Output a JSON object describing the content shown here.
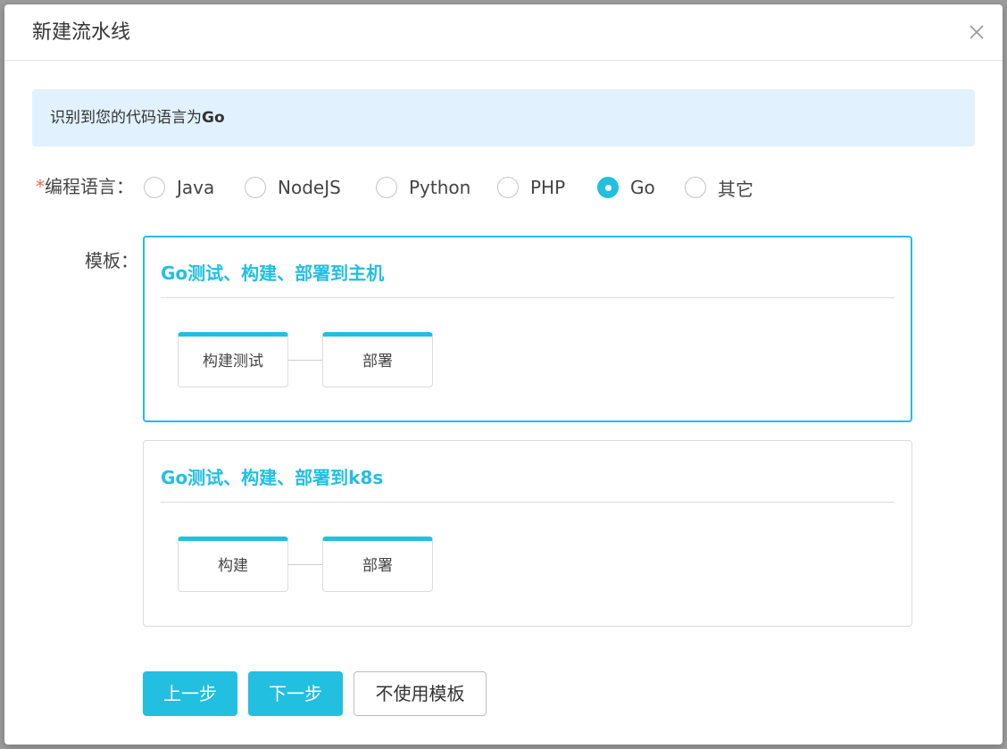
{
  "modal": {
    "title": "新建流水线",
    "close_icon": "close-icon"
  },
  "alert": {
    "prefix": "识别到您的代码语言为",
    "language": "Go"
  },
  "language_field": {
    "required_mark": "*",
    "label": "编程语言：",
    "selected": "Go",
    "options": [
      {
        "label": "Java",
        "checked": false
      },
      {
        "label": "NodeJS",
        "checked": false
      },
      {
        "label": "Python",
        "checked": false
      },
      {
        "label": "PHP",
        "checked": false
      },
      {
        "label": "Go",
        "checked": true
      },
      {
        "label": "其它",
        "checked": false
      }
    ]
  },
  "template_field": {
    "label": "模板：",
    "templates": [
      {
        "title": "Go测试、构建、部署到主机",
        "selected": true,
        "stages": [
          "构建测试",
          "部署"
        ]
      },
      {
        "title": "Go测试、构建、部署到k8s",
        "selected": false,
        "stages": [
          "构建",
          "部署"
        ]
      }
    ]
  },
  "footer": {
    "prev_label": "上一步",
    "next_label": "下一步",
    "no_template_label": "不使用模板"
  },
  "colors": {
    "accent": "#22bfe0",
    "alert_bg": "#e1f1fd",
    "required": "#e8684f"
  }
}
